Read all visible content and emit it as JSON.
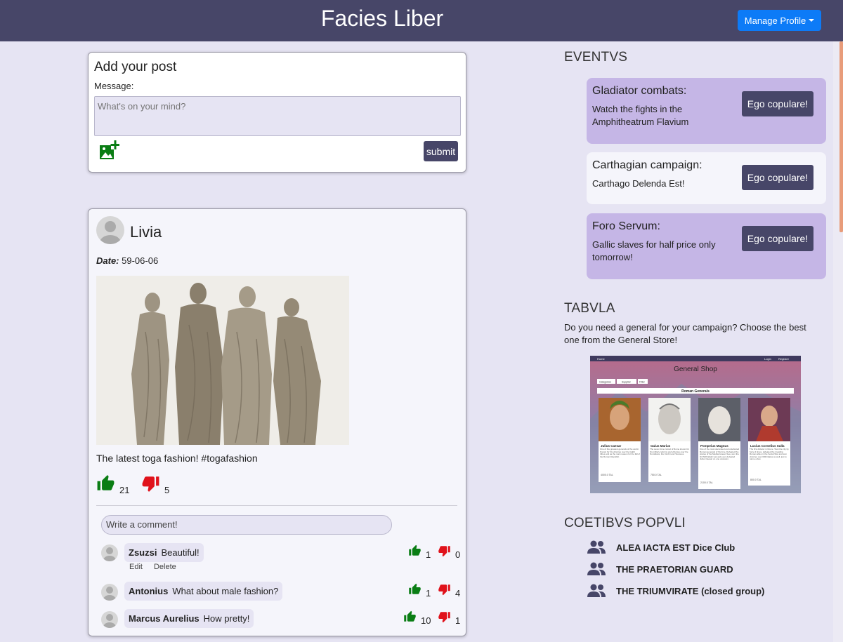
{
  "header": {
    "title": "Facies Liber",
    "manage_profile": "Manage Profile"
  },
  "add_post": {
    "title": "Add your post",
    "message_label": "Message:",
    "placeholder": "What's on your mind?",
    "submit": "submit"
  },
  "post": {
    "author": "Livia",
    "date_label": "Date:",
    "date": "59-06-06",
    "caption": "The latest toga fashion! #togafashion",
    "likes": "21",
    "dislikes": "5",
    "comment_placeholder": "Write a comment!",
    "comments": [
      {
        "author": "Zsuzsi",
        "text": "Beautiful!",
        "likes": "1",
        "dislikes": "0",
        "edit": "Edit",
        "delete": "Delete"
      },
      {
        "author": "Antonius",
        "text": "What about male fashion?",
        "likes": "1",
        "dislikes": "4"
      },
      {
        "author": "Marcus Aurelius",
        "text": "How pretty!",
        "likes": "10",
        "dislikes": "1"
      }
    ]
  },
  "events": {
    "title": "EVENTVS",
    "items": [
      {
        "title": "Gladiator combats:",
        "desc": "Watch the fights in the Amphitheatrum Flavium",
        "button": "Ego copulare!"
      },
      {
        "title": "Carthagian campaign:",
        "desc": "Carthago Delenda Est!",
        "button": "Ego copulare!"
      },
      {
        "title": "Foro Servum:",
        "desc": "Gallic slaves for half price only tomorrow!",
        "button": "Ego copulare!"
      }
    ]
  },
  "tabvla": {
    "title": "TABVLA",
    "text": "Do you need a general for your campaign? Choose the best one from the General Store!",
    "ad": {
      "nav_home": "Home",
      "nav_login": "Login",
      "nav_register": "Register",
      "shop_title": "General Shop",
      "filter_category": "Categories",
      "filter_supplier": "Supplier",
      "filter_button": "Filter",
      "subtitle": "Roman Generals",
      "cards": [
        {
          "name": "Julius Caesar",
          "desc": "One of the greatest generals of the world. Known for his victories over the Gallic tribes and as the main reason for the fall of the Roman Republic.",
          "price": "4000.0 TAL"
        },
        {
          "name": "Gaius Marius",
          "desc": "The seven time consul of Rome known for his military reforms and victories over the Numidians, the Cimbri and Teutones.",
          "price": "750.0 TAL"
        },
        {
          "name": "Pompeius Magnus",
          "desc": "One of the most decorated and celebrated Roman generals of his time. Defeated the pirates of the Mediterranean Sea, won the 3rd Mithridatic war and even defeated Julius Caesar on one occasion.",
          "price": "2100.0 TAL"
        },
        {
          "name": "Lucius Cornelius Sulla",
          "desc": "The first dictator in Rome. Took the city by force 2 times, defeated the invading Roman allies in the Social War and won victories over Mithridates as well, just to name a few.",
          "price": "800.0 TAL"
        }
      ]
    }
  },
  "groups": {
    "title": "COETIBVS POPVLI",
    "items": [
      "ALEA IACTA EST Dice Club",
      "THE PRAETORIAN GUARD",
      "THE TRIUMVIRATE (closed group)"
    ]
  },
  "colors": {
    "header": "#474668",
    "primary": "#0d7bf7",
    "like": "#0a7d14",
    "dislike": "#e0121b",
    "event_highlight": "#c5b6e6"
  }
}
